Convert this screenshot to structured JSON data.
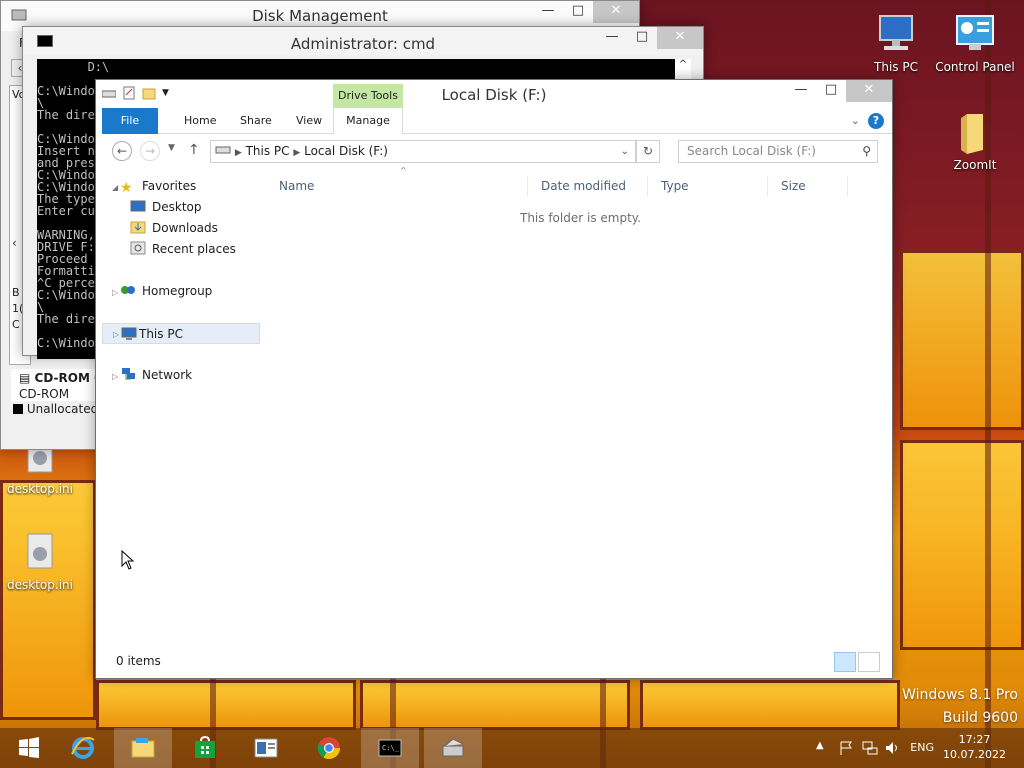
{
  "desktop": {
    "icons": [
      {
        "label": "This PC"
      },
      {
        "label": "Control Panel"
      },
      {
        "label": "ZoomIt"
      },
      {
        "label": "desktop.ini"
      },
      {
        "label": "desktop.ini"
      }
    ],
    "watermark": [
      "Windows 8.1 Pro",
      "Build 9600"
    ]
  },
  "disk_mgmt": {
    "title": "Disk Management",
    "menu_first": "Fi",
    "side_letters": [
      "Vo",
      "B",
      "1(",
      "C"
    ],
    "cdrom_label": "CD-ROM 0",
    "cdrom_type": "CD-ROM",
    "legend_unallocated": "Unallocated"
  },
  "cmd": {
    "title": "Administrator:  cmd",
    "lines": [
      "       D:\\",
      "",
      "C:\\Windo",
      "\\",
      "The dire",
      "",
      "C:\\Windo",
      "Insert n",
      "and pres",
      "C:\\Windo",
      "C:\\Windo",
      "The type",
      "Enter cu",
      "",
      "WARNING,",
      "DRIVE F:",
      "Proceed",
      "Formatti",
      "^C perce",
      "C:\\Windo",
      "\\",
      "The dire",
      "",
      "C:\\Windo"
    ]
  },
  "explorer": {
    "title": "Local Disk (F:)",
    "context_tab": "Drive Tools",
    "tabs": [
      "File",
      "Home",
      "Share",
      "View",
      "Manage"
    ],
    "help": "?",
    "breadcrumb": [
      "This PC",
      "Local Disk (F:)"
    ],
    "search_placeholder": "Search Local Disk (F:)",
    "nav": {
      "favorites": "Favorites",
      "desktop": "Desktop",
      "downloads": "Downloads",
      "recent": "Recent places",
      "homegroup": "Homegroup",
      "this_pc": "This PC",
      "network": "Network"
    },
    "columns": [
      "Name",
      "Date modified",
      "Type",
      "Size"
    ],
    "empty_message": "This folder is empty.",
    "status": "0 items"
  },
  "taskbar": {
    "apps": [
      "start-icon",
      "internet-explorer-icon",
      "file-explorer-icon",
      "store-icon",
      "document-icon",
      "chrome-icon",
      "cmd-icon",
      "disk-management-icon"
    ],
    "language": "ENG",
    "time": "17:27",
    "date": "10.07.2022"
  },
  "colors": {
    "accent": "#1979ca",
    "drive_tools": "#c4e8a4"
  }
}
